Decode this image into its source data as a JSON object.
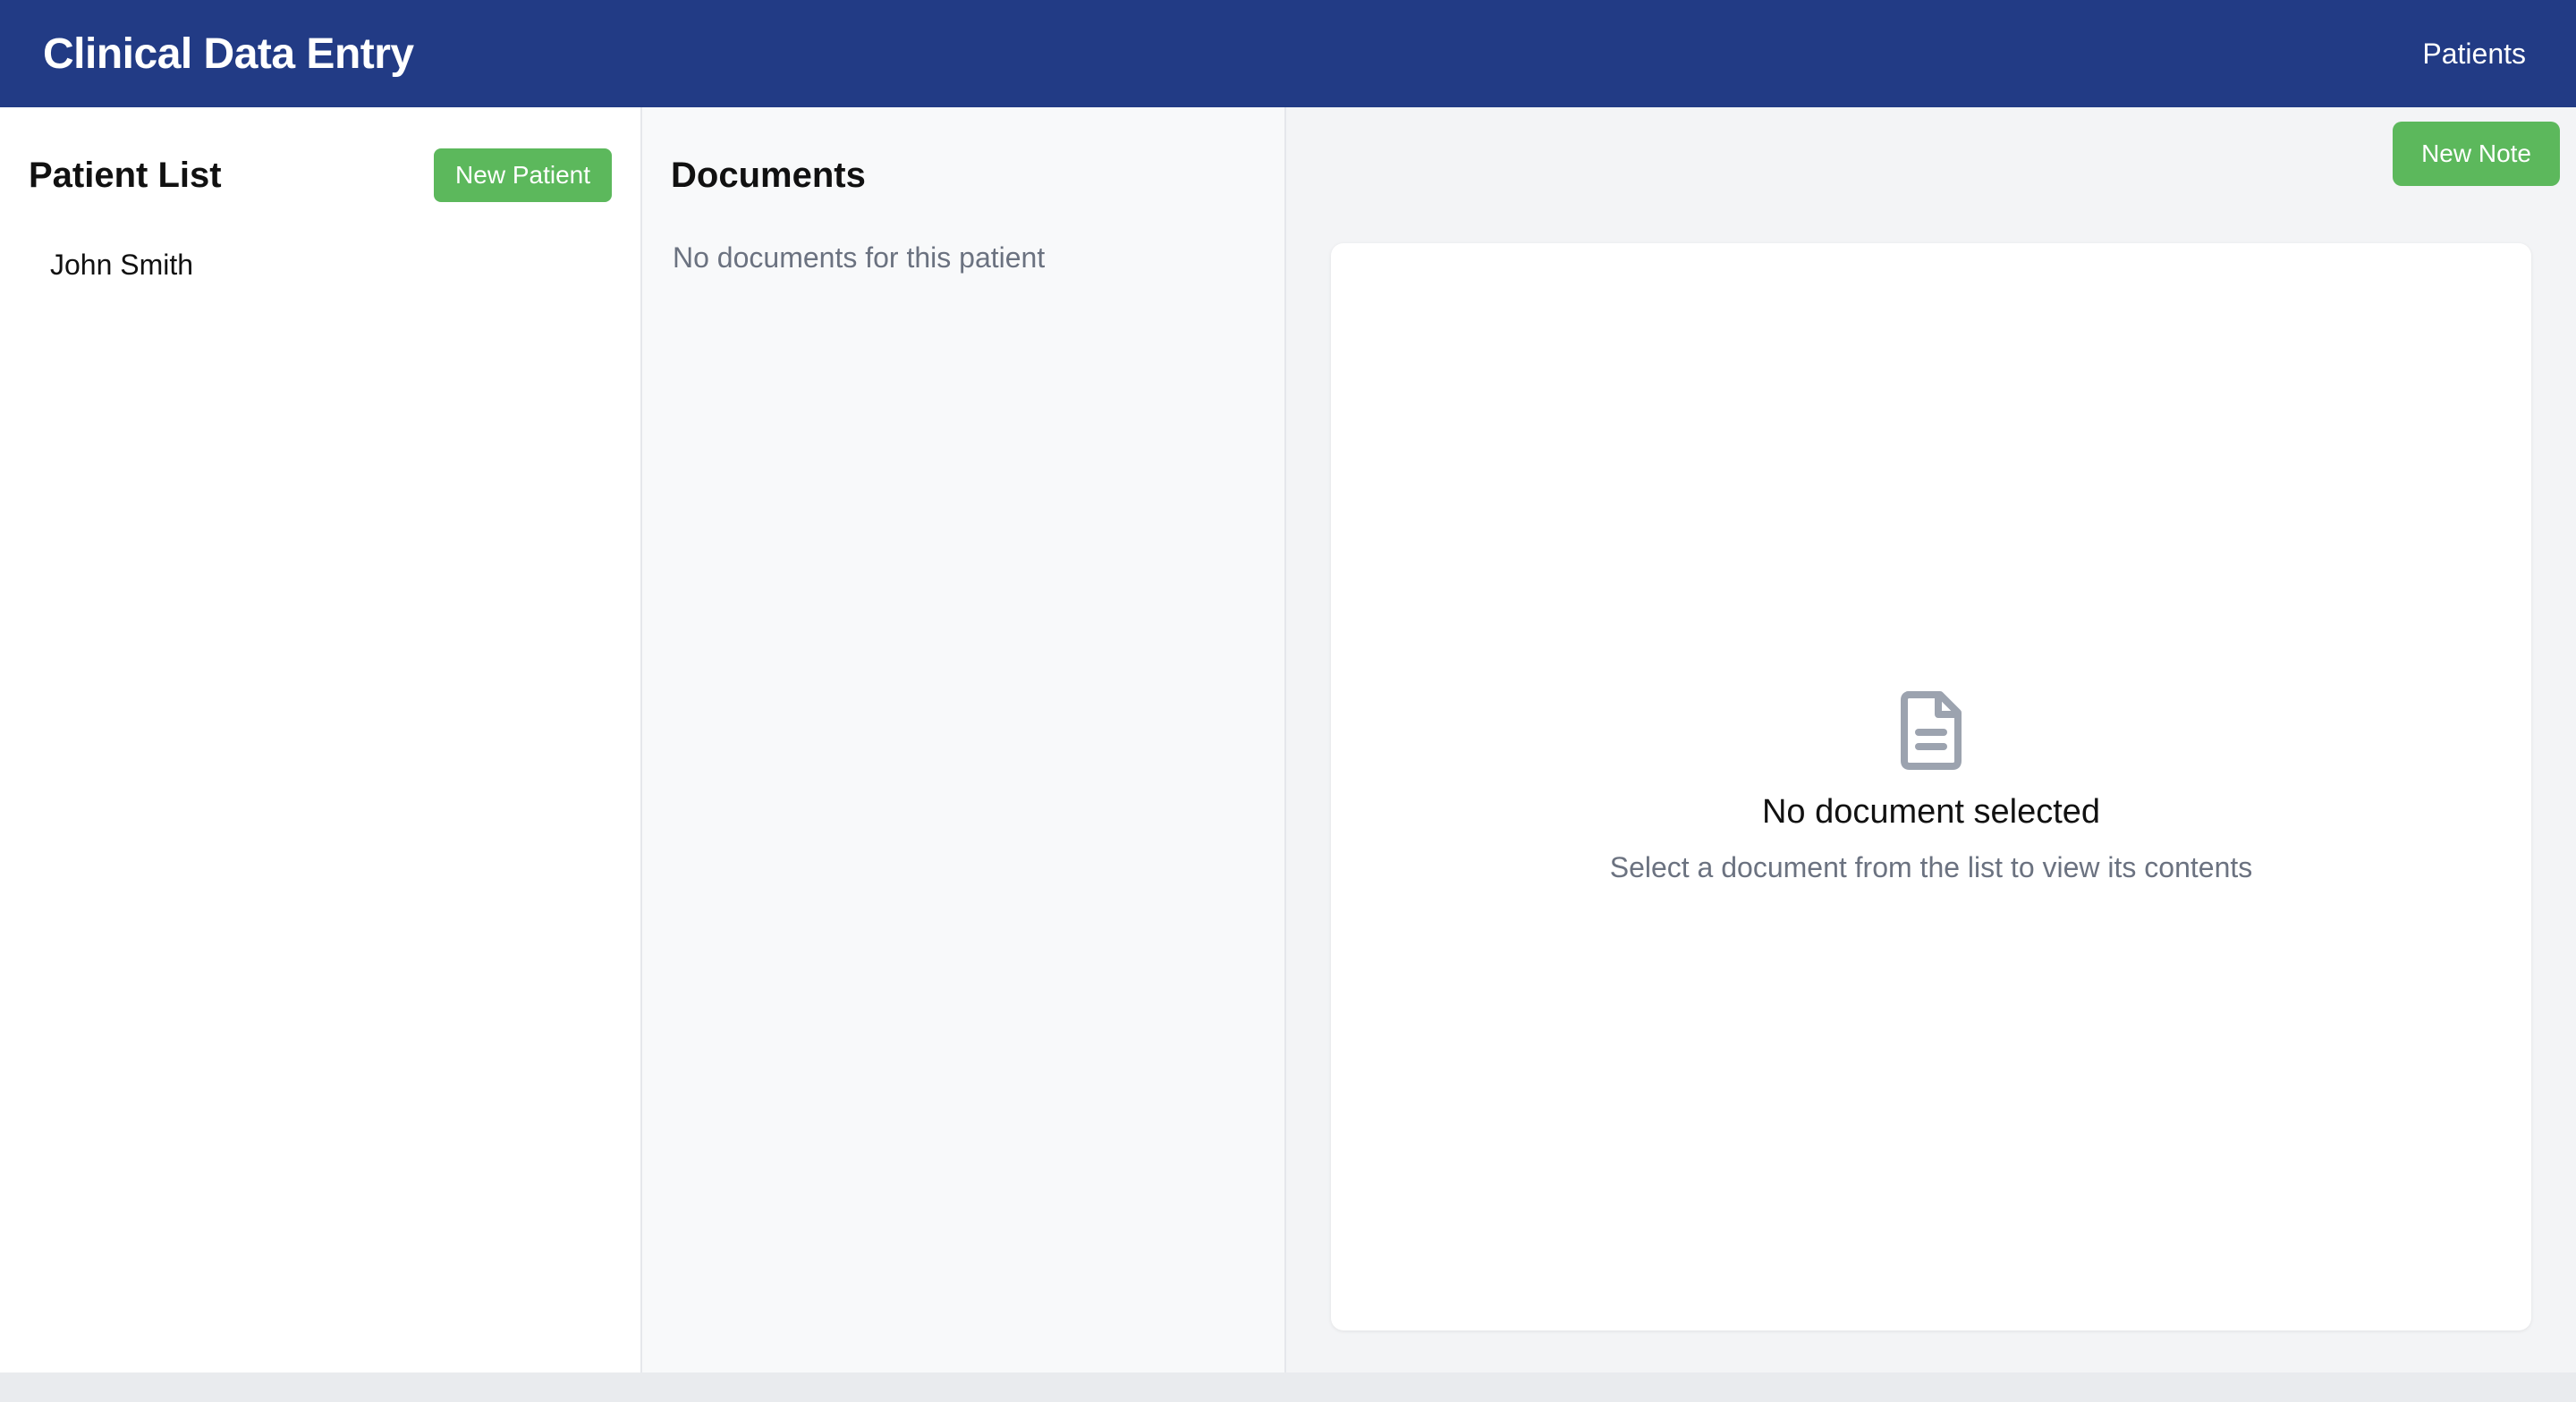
{
  "header": {
    "title": "Clinical Data Entry",
    "nav_patients": "Patients",
    "color": "#223b85"
  },
  "patients": {
    "title": "Patient List",
    "new_button": "New Patient",
    "items": [
      {
        "name": "John Smith"
      }
    ]
  },
  "documents": {
    "title": "Documents",
    "empty_text": "No documents for this patient"
  },
  "viewer": {
    "new_note_button": "New Note",
    "empty_icon": "document-icon",
    "empty_title": "No document selected",
    "empty_subtitle": "Select a document from the list to view its contents"
  },
  "colors": {
    "accent_green": "#5cb85c",
    "muted_text": "#6b7280"
  }
}
